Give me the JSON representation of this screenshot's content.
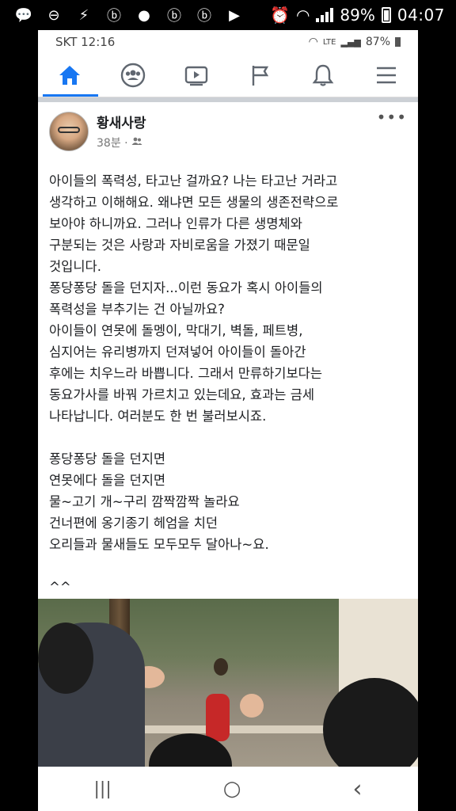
{
  "outer_status": {
    "icons": [
      "chat-bubble-icon",
      "do-not-disturb-icon",
      "vpn-icon",
      "b-app-icon",
      "messenger-icon",
      "b-app-icon",
      "b-app-icon",
      "youtube-icon",
      "alarm-icon",
      "wifi-icon",
      "signal-icon",
      "battery-icon"
    ],
    "battery": "89%",
    "time": "04:07"
  },
  "inner_status": {
    "carrier_time": "SKT 12:16",
    "network": "LTE",
    "battery": "87%"
  },
  "nav": {
    "tabs": [
      "home-icon",
      "groups-icon",
      "watch-icon",
      "pages-flag-icon",
      "notifications-bell-icon",
      "menu-icon"
    ],
    "active_color": "#1877f2"
  },
  "post": {
    "author": "황새사랑",
    "time": "38분 ·",
    "audience_icon": "friends-icon",
    "more": "•••",
    "paragraphs": [
      "아이들의 폭력성, 타고난 걸까요? 나는 타고난 거라고\n생각하고 이해해요.  왜냐면 모든 생물의 생존전략으로\n보아야 하니까요. 그러나 인류가 다른 생명체와\n구분되는 것은 사랑과 자비로움을 가졌기 때문일\n것입니다.",
      "퐁당퐁당 돌을 던지자...이런 동요가 혹시 아이들의\n폭력성을 부추기는 건 아닐까요?",
      "아이들이 연못에 돌멩이, 막대기, 벽돌, 페트병,\n심지어는 유리병까지 던져넣어 아이들이 돌아간\n후에는 치우느라 바쁩니다. 그래서 만류하기보다는\n동요가사를 바꿔 가르치고 있는데요, 효과는 금세\n나타납니다. 여러분도 한 번 불러보시죠."
    ],
    "song": "퐁당퐁당 돌을 던지면\n연못에다 돌을 던지면\n물~고기 개~구리 깜짝깜짝 놀라요\n건너편에 옹기종기 헤엄을 치던\n오리들과 물새들도 모두모두 달아나~요.",
    "ending": "^^"
  },
  "android_nav": {
    "recents": "|||",
    "home": "○",
    "back": "‹"
  }
}
